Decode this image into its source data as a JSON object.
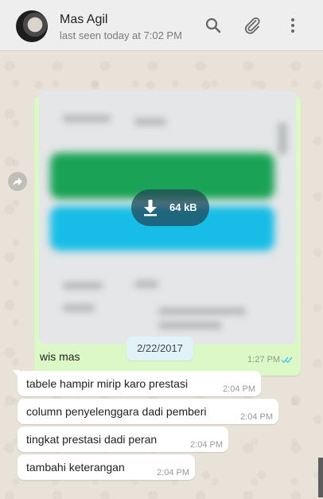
{
  "header": {
    "contact_name": "Mas Agil",
    "last_seen": "last seen today at 7:02 PM",
    "icons": [
      "search-icon",
      "attach-icon",
      "menu-icon"
    ]
  },
  "image_message": {
    "download_size": "64 kB",
    "caption": "wis mas",
    "time": "1:27 PM",
    "status": "read"
  },
  "date_chip": "2/22/2017",
  "messages": [
    {
      "text": "tabele hampir mirip karo prestasi",
      "time": "2:04 PM"
    },
    {
      "text": "column penyelenggara dadi pemberi",
      "time": "2:04 PM"
    },
    {
      "text": "tingkat prestasi dadi peran",
      "time": "2:04 PM"
    },
    {
      "text": "tambahi keterangan",
      "time": "2:04 PM"
    }
  ],
  "colors": {
    "outgoing_bubble": "#dcf8c6",
    "incoming_bubble": "#ffffff",
    "header_bg": "#eeeeee",
    "read_ticks": "#4fc3f7"
  }
}
